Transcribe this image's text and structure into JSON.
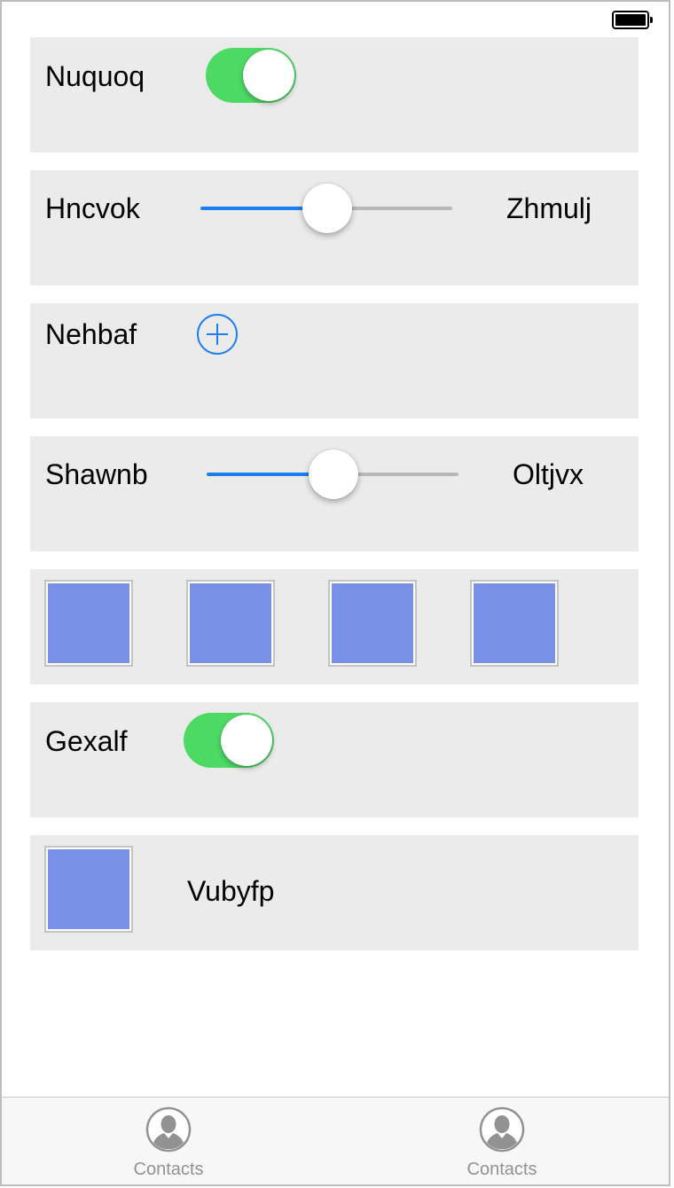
{
  "rows": {
    "row1": {
      "label": "Nuquoq",
      "toggle_on": true
    },
    "row2": {
      "label": "Hncvok",
      "slider_value": 0.5,
      "trailing_label": "Zhmulj"
    },
    "row3": {
      "label": "Nehbaf",
      "button_icon": "add-circle-icon"
    },
    "row4": {
      "label": "Shawnb",
      "slider_value": 0.5,
      "trailing_label": "Oltjvx"
    },
    "row5": {
      "image_count": 4
    },
    "row6": {
      "label": "Gexalf",
      "toggle_on": true
    },
    "row7": {
      "label": "Vubyfp"
    }
  },
  "tabbar": {
    "tabs": [
      {
        "label": "Contacts",
        "icon": "contact-icon"
      },
      {
        "label": "Contacts",
        "icon": "contact-icon"
      }
    ]
  },
  "colors": {
    "accent": "#1b7ef2",
    "toggle_on": "#4cd964",
    "row_background": "#ebebeb",
    "image_fill": "#7890e5",
    "tab_label": "#929292"
  }
}
